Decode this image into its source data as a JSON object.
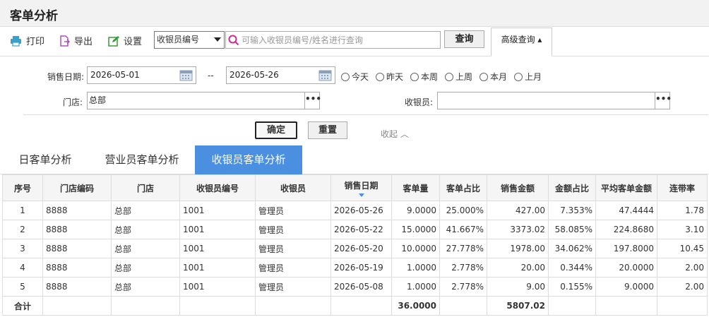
{
  "page": {
    "title": "客单分析"
  },
  "toolbar": {
    "print_label": "打印",
    "export_label": "导出",
    "settings_label": "设置",
    "search_field": "收银员编号",
    "search_placeholder": "可输入收银员编号/姓名进行查询",
    "query_label": "查询",
    "advanced_label": "高级查询 ▴"
  },
  "filter": {
    "date_label": "销售日期:",
    "date_from": "2026-05-01",
    "date_sep": "--",
    "date_to": "2026-05-26",
    "quick_ranges": [
      "今天",
      "昨天",
      "本周",
      "上周",
      "本月",
      "上月"
    ],
    "store_label": "门店:",
    "store_value": "总部",
    "cashier_label": "收银员:",
    "cashier_value": "",
    "more_glyph": "•••",
    "confirm_label": "确定",
    "reset_label": "重置",
    "collapse_label": "收起 ︿"
  },
  "tabs": [
    {
      "label": "日客单分析"
    },
    {
      "label": "营业员客单分析"
    },
    {
      "label": "收银员客单分析"
    }
  ],
  "table": {
    "headers": [
      "序号",
      "门店编码",
      "门店",
      "收银员编号",
      "收银员",
      "销售日期",
      "客单量",
      "客单占比",
      "销售金额",
      "金额占比",
      "平均客单金额",
      "连带率"
    ],
    "rows": [
      [
        "1",
        "8888",
        "总部",
        "1001",
        "管理员",
        "2026-05-26",
        "9.0000",
        "25.000%",
        "427.00",
        "7.353%",
        "47.4444",
        "1.78"
      ],
      [
        "2",
        "8888",
        "总部",
        "1001",
        "管理员",
        "2026-05-22",
        "15.0000",
        "41.667%",
        "3373.02",
        "58.085%",
        "224.8680",
        "3.10"
      ],
      [
        "3",
        "8888",
        "总部",
        "1001",
        "管理员",
        "2026-05-20",
        "10.0000",
        "27.778%",
        "1978.00",
        "34.062%",
        "197.8000",
        "10.45"
      ],
      [
        "4",
        "8888",
        "总部",
        "1001",
        "管理员",
        "2026-05-19",
        "1.0000",
        "2.778%",
        "20.00",
        "0.344%",
        "20.0000",
        "2.00"
      ],
      [
        "5",
        "8888",
        "总部",
        "1001",
        "管理员",
        "2026-05-08",
        "1.0000",
        "2.778%",
        "9.00",
        "0.155%",
        "9.0000",
        "2.00"
      ]
    ],
    "total": {
      "label": "合计",
      "count": "36.0000",
      "amount": "5807.02"
    }
  }
}
